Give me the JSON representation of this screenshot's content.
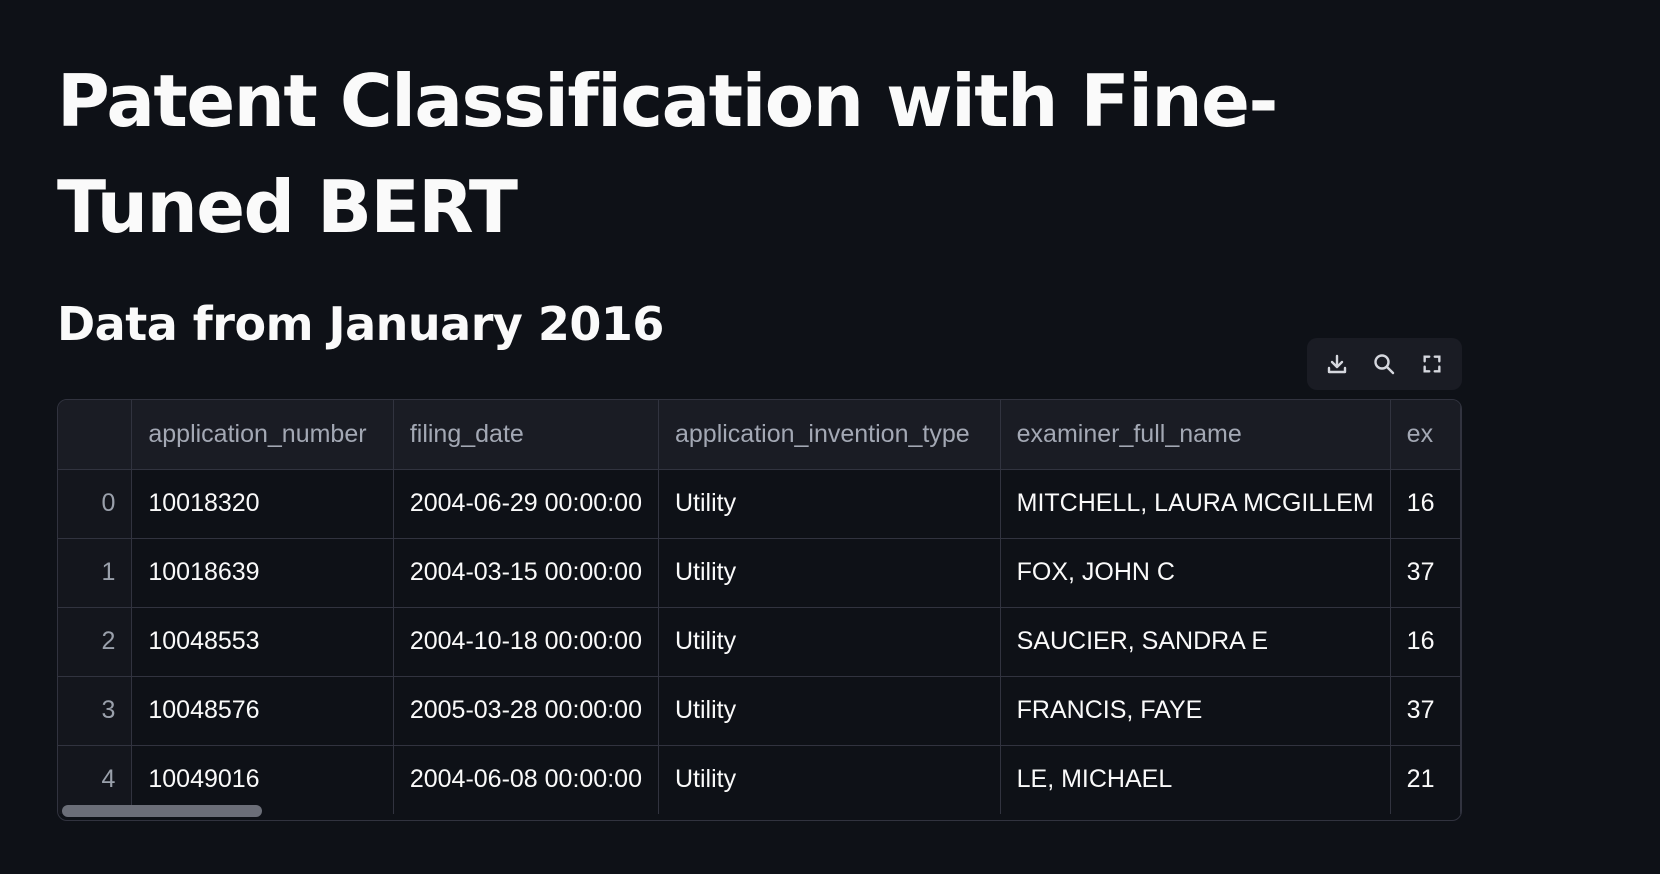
{
  "page": {
    "title": "Patent Classification with Fine-Tuned BERT",
    "subheader": "Data from January 2016"
  },
  "toolbar": {
    "download_icon": "download-icon",
    "search_icon": "search-icon",
    "fullscreen_icon": "fullscreen-icon"
  },
  "table": {
    "columns": [
      "",
      "application_number",
      "filing_date",
      "application_invention_type",
      "examiner_full_name",
      "ex"
    ],
    "rows": [
      {
        "index": "0",
        "application_number": "10018320",
        "filing_date": "2004-06-29 00:00:00",
        "invention_type": "Utility",
        "examiner": "MITCHELL, LAURA MCGILLEM",
        "next": "16"
      },
      {
        "index": "1",
        "application_number": "10018639",
        "filing_date": "2004-03-15 00:00:00",
        "invention_type": "Utility",
        "examiner": "FOX, JOHN C",
        "next": "37"
      },
      {
        "index": "2",
        "application_number": "10048553",
        "filing_date": "2004-10-18 00:00:00",
        "invention_type": "Utility",
        "examiner": "SAUCIER, SANDRA E",
        "next": "16"
      },
      {
        "index": "3",
        "application_number": "10048576",
        "filing_date": "2005-03-28 00:00:00",
        "invention_type": "Utility",
        "examiner": "FRANCIS, FAYE",
        "next": "37"
      },
      {
        "index": "4",
        "application_number": "10049016",
        "filing_date": "2004-06-08 00:00:00",
        "invention_type": "Utility",
        "examiner": "LE, MICHAEL",
        "next": "21"
      }
    ]
  },
  "colors": {
    "background": "#0e1117",
    "header_bg": "#1a1c24",
    "border": "#31333f",
    "text": "#fafafa",
    "muted": "#a3a8b4"
  }
}
